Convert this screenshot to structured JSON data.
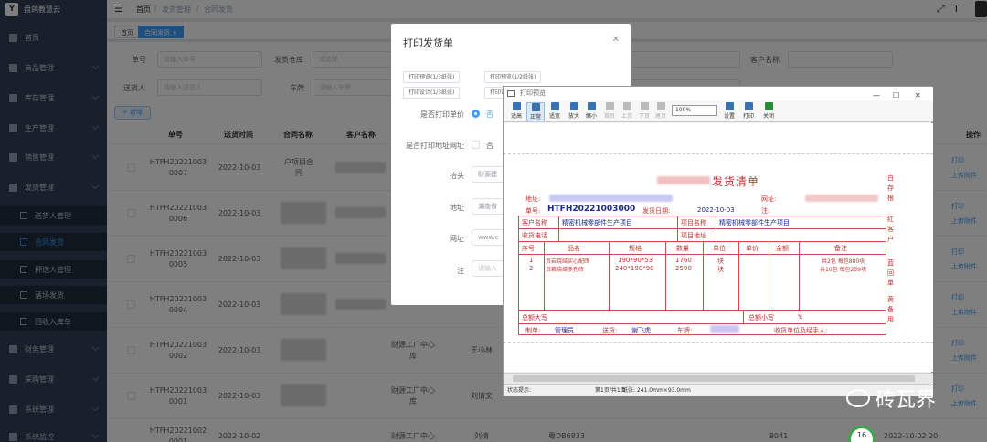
{
  "app": {
    "logo_letter": "Y",
    "name": "盘鸽教慧云"
  },
  "sidebar": {
    "items": [
      {
        "label": "首页"
      },
      {
        "label": "商品管理"
      },
      {
        "label": "库存管理"
      },
      {
        "label": "生产管理"
      },
      {
        "label": "销售管理"
      },
      {
        "label": "发货管理"
      }
    ],
    "subitems": [
      {
        "label": "送货人管理"
      },
      {
        "label": "合同发货"
      },
      {
        "label": "押送人管理"
      },
      {
        "label": "落场发货"
      },
      {
        "label": "回收入库单"
      }
    ],
    "bottom": [
      {
        "label": "财务管理"
      },
      {
        "label": "采购管理"
      },
      {
        "label": "系统管理"
      },
      {
        "label": "系统监控"
      }
    ]
  },
  "breadcrumb": [
    "首页",
    "发货管理",
    "合同发货"
  ],
  "tags": [
    "首页",
    "合同发货 ×"
  ],
  "filters": {
    "order_no_label": "单号",
    "order_no_ph": "请输入单号",
    "warehouse_label": "发货仓库",
    "warehouse_ph": "请选择",
    "customer_label": "客户名称",
    "shipper_label": "送货人",
    "shipper_ph": "请输入送货人",
    "vehicle_label": "车牌",
    "vehicle_ph": "请输入车牌"
  },
  "add_button": "+ 新增",
  "table": {
    "headers": [
      "单号",
      "送货时间",
      "合同名称",
      "客户名称",
      "操作"
    ],
    "rows": [
      {
        "no": "HTFH20221003\n0007",
        "date": "2022-10-03",
        "contract": "户项目合\n同",
        "customer": "",
        "extra": ""
      },
      {
        "no": "HTFH20221003\n0006",
        "date": "2022-10-03",
        "contract": "",
        "customer": "",
        "extra": ""
      },
      {
        "no": "HTFH20221003\n0005",
        "date": "2022-10-03",
        "contract": "",
        "customer": "",
        "extra": ""
      },
      {
        "no": "HTFH20221003\n0004",
        "date": "2022-10-03",
        "contract": "",
        "customer": "",
        "extra": ""
      },
      {
        "no": "HTFH20221003\n0002",
        "date": "2022-10-03",
        "contract": "",
        "customer": "财源工厂中心\n库",
        "extra": "王小林"
      },
      {
        "no": "HTFH20221003\n0001",
        "date": "2022-10-03",
        "contract": "",
        "customer": "财源工厂中心\n库",
        "extra": "刘倩文"
      },
      {
        "no": "HTFH20221002\n0001",
        "date": "2022-10-02",
        "contract": "",
        "customer": "财源工厂中心",
        "extra": "刘倩"
      }
    ],
    "row_links": [
      "打印",
      "上传附件"
    ],
    "last_row_extra": [
      "粤DB6833",
      "8041",
      "2022-10-02 20:"
    ]
  },
  "dialog": {
    "title": "打印发货单",
    "buttons": [
      "打印预览(1/3纸张)",
      "打印预览(1/2纸张)",
      "打印设计(1/3纸张)",
      "打印设计(1/2纸张)"
    ],
    "print_price_label": "是否打印单价",
    "print_price_option": "否",
    "print_web_label": "是否打印地址网址",
    "print_web_option": "否",
    "header_label": "抬头",
    "header_value": "财源建",
    "address_label": "地址",
    "address_value": "湖南省",
    "url_label": "网址",
    "url_value": "www.c",
    "note_label": "注",
    "note_ph": "请输入"
  },
  "preview": {
    "window_title": "打印预览",
    "toolbar": [
      "适高",
      "正常",
      "适宽",
      "放大",
      "缩小",
      "首页",
      "上页",
      "下页",
      "尾页",
      "设置",
      "打印",
      "关闭"
    ],
    "zoom": "100%",
    "status": "状态提示:",
    "page_info": "第1页/共1页",
    "paper_info": "纸张: 241.0mm×93.0mm"
  },
  "doc": {
    "title": "发货清单",
    "address_label": "地址:",
    "website_label": "网址:",
    "order_label": "单号:",
    "order_no": "HTFH20221003000",
    "date_label": "发货日期:",
    "date": "2022-10-03",
    "note_label": "注:",
    "customer_label": "客户名称",
    "customer": "精密机械零部件生产项目",
    "project_label": "项目名称",
    "project": "精密机械零部件生产项目",
    "phone_label": "收货电话",
    "project_addr_label": "项目地址",
    "columns": [
      "序号",
      "品名",
      "规格",
      "数量",
      "单位",
      "单价",
      "金额",
      "备注"
    ],
    "items": [
      {
        "seq": "1",
        "name": "页岩烧结实心配砖",
        "spec": "190*90*53",
        "qty": "1760",
        "unit": "块",
        "remark": "共2包 每包880块"
      },
      {
        "seq": "2",
        "name": "页岩烧结多孔砖",
        "spec": "240*190*90",
        "qty": "2590",
        "unit": "块",
        "remark": "共10包 每包259块"
      }
    ],
    "total_upper_label": "总额大写",
    "total_lower_label": "总额小写",
    "yen": "Y:",
    "maker_label": "制单:",
    "maker": "管理员",
    "sender_label": "送货:",
    "sender": "谢飞虎",
    "car_label": "车牌:",
    "receiver_label": "收货单位及经手人:",
    "side_notes": [
      "白\n存\n根",
      "红\n客\n户",
      "蓝\n回\n单",
      "黄\n备\n用"
    ]
  },
  "watermark": "砖瓦界",
  "badge": "16"
}
